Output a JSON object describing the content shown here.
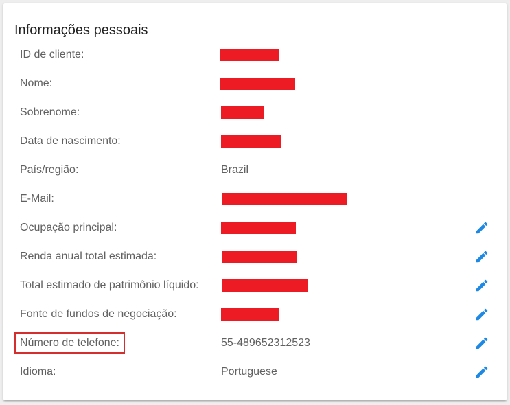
{
  "card": {
    "title": "Informações pessoais"
  },
  "rows": [
    {
      "label": "ID de cliente:",
      "value": ""
    },
    {
      "label": "Nome:",
      "value": ""
    },
    {
      "label": "Sobrenome:",
      "value": ""
    },
    {
      "label": "Data de nascimento:",
      "value": ""
    },
    {
      "label": "País/região:",
      "value": "Brazil"
    },
    {
      "label": "E-Mail:",
      "value": ""
    },
    {
      "label": "Ocupação principal:",
      "value": ""
    },
    {
      "label": "Renda anual total estimada:",
      "value": ""
    },
    {
      "label": "Total estimado de patrimônio líquido:",
      "value": ""
    },
    {
      "label": "Fonte de fundos de negociação:",
      "value": ""
    },
    {
      "label": "Número de telefone:",
      "value": "55-489652312523"
    },
    {
      "label": "Idioma:",
      "value": "Portuguese"
    }
  ],
  "icons": {
    "edit": "pencil-icon"
  },
  "colors": {
    "redaction": "#ed1c24",
    "edit_icon": "#1e88e5",
    "highlight_box": "#d32f2f"
  }
}
